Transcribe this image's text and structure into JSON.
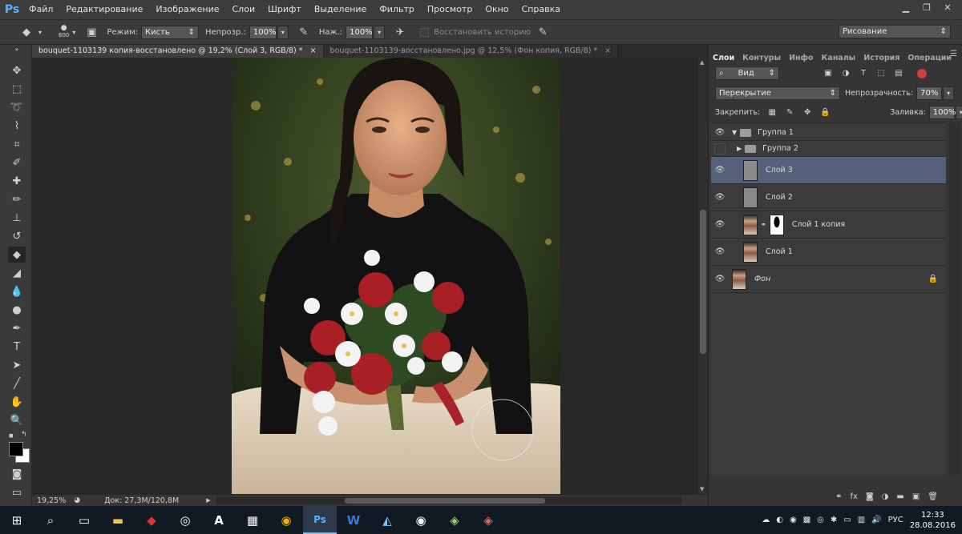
{
  "app": {
    "logo": "Ps"
  },
  "menu": [
    "Файл",
    "Редактирование",
    "Изображение",
    "Слои",
    "Шрифт",
    "Выделение",
    "Фильтр",
    "Просмотр",
    "Окно",
    "Справка"
  ],
  "options": {
    "brush_size": "600",
    "mode_label": "Режим:",
    "mode_value": "Кисть",
    "opacity_label": "Непрозр.:",
    "opacity_value": "100%",
    "pressure_label": "Наж.:",
    "pressure_value": "100%",
    "restore_history": "Восстановить историю",
    "workspace": "Рисование"
  },
  "tabs": [
    {
      "title": "bouquet-1103139 копия-восстановлено @ 19,2% (Слой 3, RGB/8) *",
      "close": "×"
    },
    {
      "title": "bouquet-1103139-восстановлено.jpg @ 12,5% (Фон копия, RGB/8) *",
      "close": "×"
    }
  ],
  "status": {
    "zoom": "19,25%",
    "doc": "Док: 27,3M/120,8M",
    "arrow": "▶"
  },
  "panel": {
    "tabs": [
      "Слои",
      "Контуры",
      "Инфо",
      "Каналы",
      "История",
      "Операции"
    ],
    "kind_filter": "Вид",
    "blend_mode": "Перекрытие",
    "opacity_label": "Непрозрачность:",
    "opacity_value": "70%",
    "lock_label": "Закрепить:",
    "fill_label": "Заливка:",
    "fill_value": "100%",
    "layers": [
      {
        "name": "Группа 1"
      },
      {
        "name": "Группа 2"
      },
      {
        "name": "Слой 3"
      },
      {
        "name": "Слой 2"
      },
      {
        "name": "Слой 1 копия"
      },
      {
        "name": "Слой 1"
      },
      {
        "name": "Фон"
      }
    ]
  },
  "taskbar": {
    "lang": "РУС",
    "time": "12:33",
    "date": "28.08.2016"
  },
  "colors": {
    "accent": "#55607a",
    "ps_blue": "#5fb0ff"
  }
}
